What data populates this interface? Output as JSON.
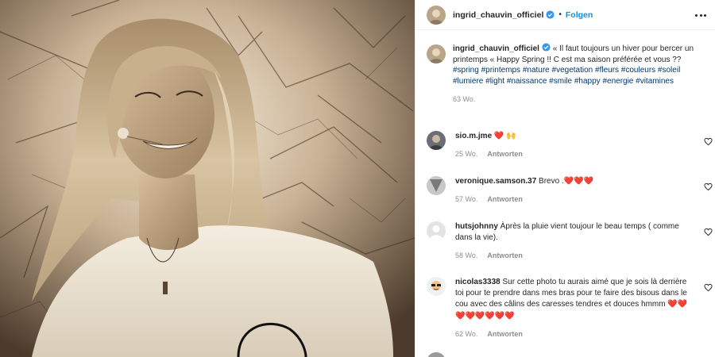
{
  "header": {
    "username": "ingrid_chauvin_officiel",
    "separator": "•",
    "follow_label": "Folgen"
  },
  "caption": {
    "username": "ingrid_chauvin_officiel",
    "text": "« Il faut toujours un hiver pour bercer un printemps «  Happy Spring !! C est ma saison préférée et vous ?? ",
    "hashtags": "#spring #printemps #nature #vegetation #fleurs #couleurs #soleil #lumiere #light #naissance #smile #happy #energie #vitamines",
    "time": "63 Wo."
  },
  "comments": [
    {
      "username": "sio.m.jme",
      "text": "",
      "emoji": "❤️ 🙌",
      "time": "25 Wo.",
      "reply_label": "Antworten"
    },
    {
      "username": "veronique.samson.37",
      "text": "Brevo .",
      "emoji": "❤️❤️❤️",
      "time": "57 Wo.",
      "reply_label": "Antworten"
    },
    {
      "username": "hutsjohnny",
      "text": "Àprès la pluie vient toujour le beau temps ( comme dans la vie).",
      "emoji": "",
      "time": "58 Wo.",
      "reply_label": "Antworten"
    },
    {
      "username": "nicolas3338",
      "text": "Sur cette photo tu aurais aimé que je sois là derrière toi pour te prendre dans mes bras pour te faire des bisous dans le cou avec des câlins des caresses tendres et douces hmmm",
      "emoji": "❤️❤️❤️❤️❤️❤️❤️❤️",
      "time": "62 Wo.",
      "reply_label": "Antworten"
    }
  ],
  "icons": {
    "verified": "verified-badge-icon",
    "more": "more-options-icon",
    "like": "heart-outline-icon"
  },
  "colors": {
    "link": "#0095f6",
    "hashtag": "#00376b",
    "muted": "#8e8e8e",
    "heart": "#ed4956"
  }
}
